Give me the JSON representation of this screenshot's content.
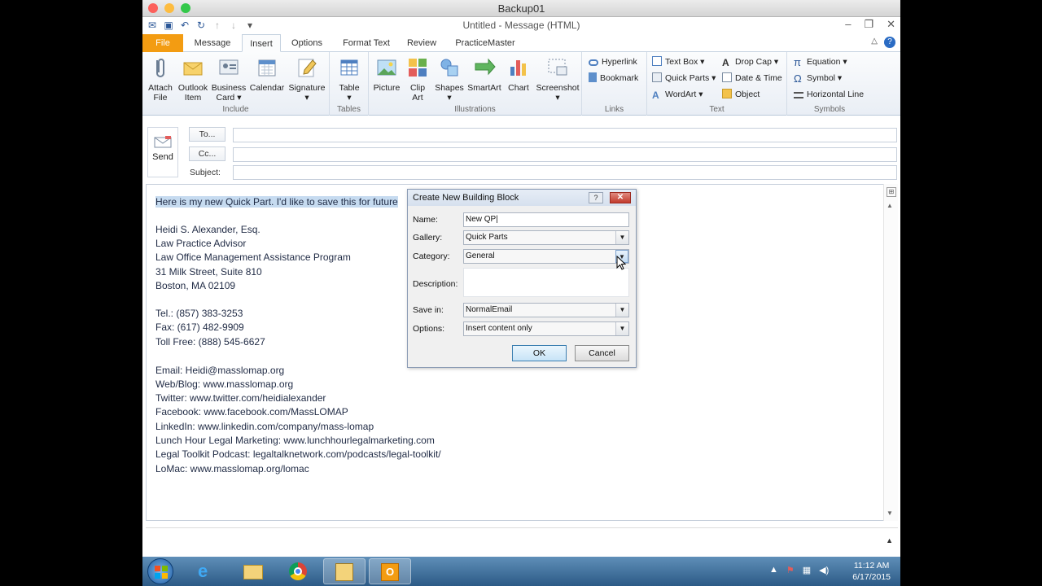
{
  "mac_window": {
    "title": "Backup01"
  },
  "outlook": {
    "title": "Untitled - Message (HTML)",
    "tabs": [
      "File",
      "Message",
      "Insert",
      "Options",
      "Format Text",
      "Review",
      "PracticeMaster"
    ]
  },
  "ribbon": {
    "include": {
      "label": "Include",
      "buttons": [
        {
          "line1": "Attach",
          "line2": "File"
        },
        {
          "line1": "Outlook",
          "line2": "Item"
        },
        {
          "line1": "Business",
          "line2": "Card ▾"
        },
        {
          "line1": "Calendar",
          "line2": ""
        },
        {
          "line1": "Signature",
          "line2": "▾"
        }
      ]
    },
    "tables": {
      "label": "Tables",
      "buttons": [
        {
          "line1": "Table",
          "line2": "▾"
        }
      ]
    },
    "illustrations": {
      "label": "Illustrations",
      "buttons": [
        {
          "line1": "Picture",
          "line2": ""
        },
        {
          "line1": "Clip",
          "line2": "Art"
        },
        {
          "line1": "Shapes",
          "line2": "▾"
        },
        {
          "line1": "SmartArt",
          "line2": ""
        },
        {
          "line1": "Chart",
          "line2": ""
        },
        {
          "line1": "Screenshot",
          "line2": "▾"
        }
      ]
    },
    "links": {
      "label": "Links",
      "items": [
        "Hyperlink",
        "Bookmark"
      ]
    },
    "text": {
      "label": "Text",
      "items": [
        "Text Box ▾",
        "Quick Parts ▾",
        "WordArt ▾",
        "Drop Cap ▾",
        "Date & Time",
        "Object"
      ]
    },
    "symbols": {
      "label": "Symbols",
      "items": [
        "Equation ▾",
        "Symbol ▾",
        "Horizontal Line"
      ]
    }
  },
  "header": {
    "send_label": "Send",
    "to_label": "To...",
    "cc_label": "Cc...",
    "subject_label": "Subject:"
  },
  "body_lines": [
    "Here is my new Quick Part. I'd like to save this for future",
    "Heidi S. Alexander, Esq.",
    "Law Practice Advisor",
    "Law Office Management Assistance Program",
    "31 Milk Street, Suite 810",
    "Boston, MA 02109",
    "Tel.: (857) 383-3253",
    "Fax: (617) 482-9909",
    "Toll Free: (888) 545-6627",
    "Email: Heidi@masslomap.org",
    "Web/Blog: www.masslomap.org",
    "Twitter: www.twitter.com/heidialexander",
    "Facebook: www.facebook.com/MassLOMAP",
    "LinkedIn: www.linkedin.com/company/mass-lomap",
    "Lunch Hour Legal Marketing: www.lunchhourlegalmarketing.com",
    "Legal Toolkit Podcast: legaltalknetwork.com/podcasts/legal-toolkit/",
    "LoMac: www.masslomap.org/lomac"
  ],
  "dialog": {
    "title": "Create New Building Block",
    "help": "?",
    "close": "✕",
    "name_label": "Name:",
    "name_value": "New QP|",
    "gallery_label": "Gallery:",
    "gallery_value": "Quick Parts",
    "category_label": "Category:",
    "category_value": "General",
    "description_label": "Description:",
    "description_value": "",
    "savein_label": "Save in:",
    "savein_value": "NormalEmail",
    "options_label": "Options:",
    "options_value": "Insert content only",
    "ok": "OK",
    "cancel": "Cancel"
  },
  "taskbar": {
    "time": "11:12 AM",
    "date": "6/17/2015"
  },
  "colors": {
    "file_tab": "#f39c12",
    "selection": "#c6dbf0",
    "taskbar": "#2c5a86"
  }
}
